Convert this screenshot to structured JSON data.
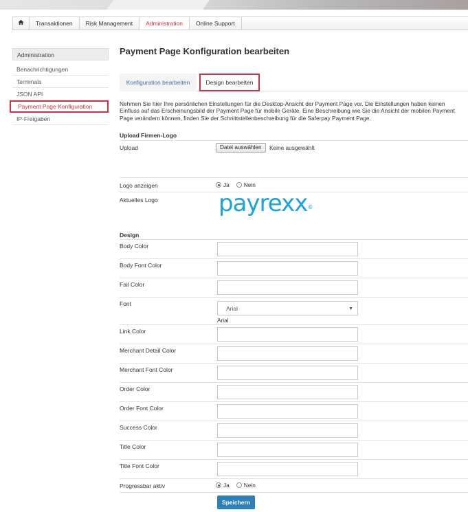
{
  "nav": {
    "tabs": [
      "Transaktionen",
      "Risk Management",
      "Administration",
      "Online Support"
    ],
    "active_tab": "Administration"
  },
  "sidebar": {
    "header": "Administration",
    "items": [
      "Benachrichtigungen",
      "Terminals",
      "JSON API",
      "Payment Page Konfiguration",
      "IP-Freigaben"
    ],
    "active_item": "Payment Page Konfiguration"
  },
  "page": {
    "title": "Payment Page Konfiguration bearbeiten",
    "subtabs": [
      "Konfiguration bearbeiten",
      "Design bearbeiten"
    ],
    "active_subtab": "Design bearbeiten",
    "intro": "Nehmen Sie hier Ihre persönlichen Einstellungen für die Desktop-Ansicht der Payment Page vor. Die Einstellungen haben keinen Einfluss auf das Erscheinungsbild der Payment Page für mobile Geräte. Eine Beschreibung wie Sie die Ansicht der mobilen Payment Page verändern können, finden Sie der Schnittstellenbeschreibung für die Saferpay Payment Page."
  },
  "logo_section": {
    "heading": "Upload Firmen-Logo",
    "upload_label": "Upload",
    "file_button": "Datei auswählen",
    "file_status": "Keine ausgewählt",
    "show_logo_label": "Logo anzeigen",
    "show_logo_options": [
      "Ja",
      "Nein"
    ],
    "show_logo_value": "Ja",
    "current_logo_label": "Aktuelles Logo",
    "logo_text": "payrexx",
    "logo_color": "#1aa3e0"
  },
  "design": {
    "heading": "Design",
    "body_color": "Body Color",
    "body_font_color": "Body Font Color",
    "fail_color": "Fail Color",
    "font_label": "Font",
    "font_value": "Arial",
    "font_selected_text": "Arial",
    "link_color": "Link Color",
    "merchant_detail_color": "Merchant Detail Color",
    "merchant_font_color": "Merchant Font Color",
    "order_color": "Order Color",
    "order_font_color": "Order Font Color",
    "success_color": "Success Color",
    "title_color": "Title Color",
    "title_font_color": "Title Font Color",
    "progressbar_label": "Progressbar aktiv",
    "progressbar_options": [
      "Ja",
      "Nein"
    ],
    "progressbar_value": "Ja",
    "save_button": "Speichern"
  },
  "colors": {
    "accent_red": "#d2323f",
    "link_blue": "#3a6ea5",
    "button_blue": "#2c7fb8"
  }
}
